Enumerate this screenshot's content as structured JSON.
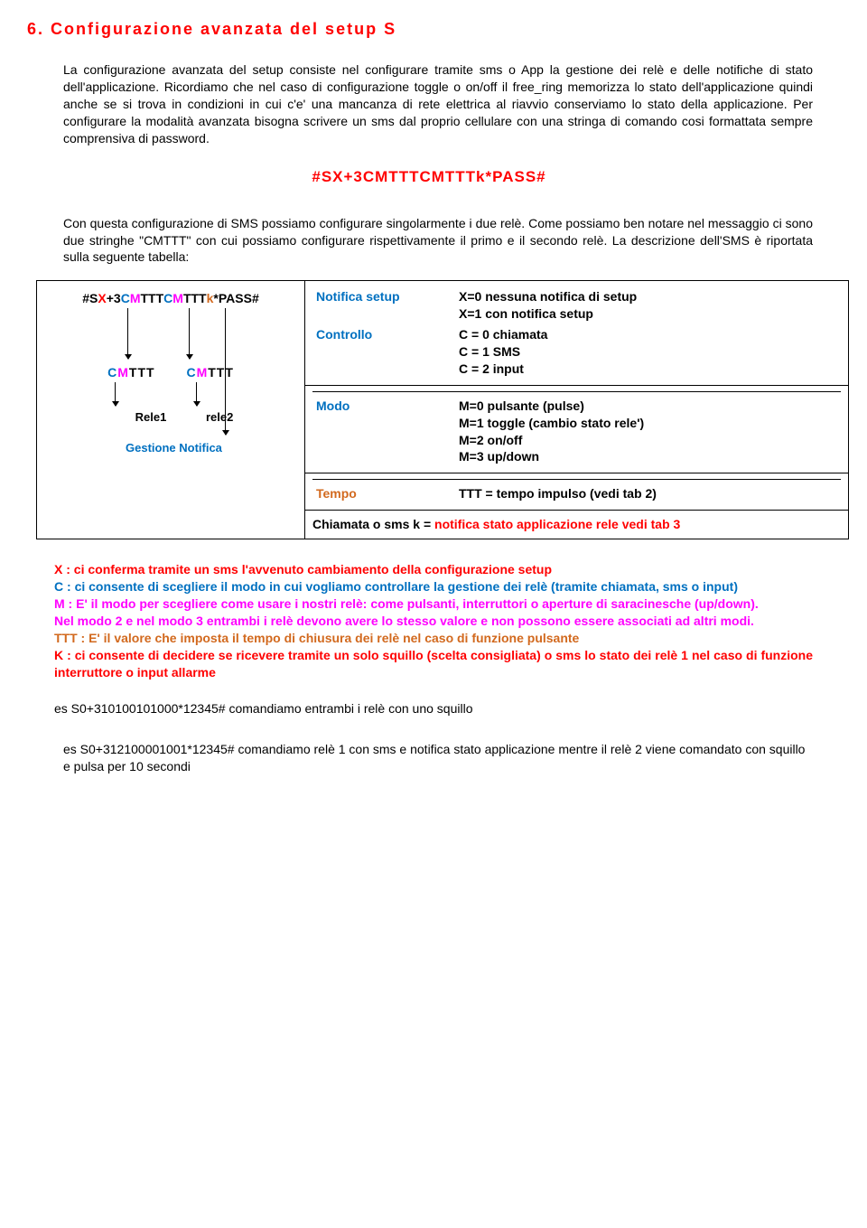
{
  "title": "6. Configurazione avanzata del setup S",
  "intro": "La configurazione avanzata del setup consiste nel configurare tramite sms o App la gestione dei relè e delle notifiche di stato dell'applicazione. Ricordiamo che nel caso di configurazione toggle o on/off il free_ring memorizza lo stato dell'applicazione quindi anche se si trova in condizioni in cui c'e' una mancanza di rete elettrica al riavvio conserviamo lo stato della applicazione. Per configurare la modalità avanzata bisogna scrivere un sms dal proprio cellulare con una stringa di comando cosi formattata sempre comprensiva di password.",
  "command": "#SX+3CMTTTCMTTTk*PASS#",
  "after": "Con questa configurazione di SMS possiamo configurare singolarmente i due relè. Come possiamo ben notare nel messaggio ci sono due stringhe \"CMTTT\" con cui possiamo configurare rispettivamente il primo e il secondo relè. La descrizione dell'SMS è riportata sulla seguente tabella:",
  "diagram": {
    "top": "#SX+3CMTTTCMTTTk*PASS#",
    "cm1": "CMTTT",
    "cm2": "CMTTT",
    "rele1": "Rele1",
    "rele2": "rele2",
    "gest": "Gestione Notifica"
  },
  "table": {
    "notifica_lbl": "Notifica setup",
    "notifica_val": "X=0 nessuna notifica di setup\nX=1 con notifica setup",
    "controllo_lbl": "Controllo",
    "controllo_val": "C = 0 chiamata\nC = 1 SMS\nC = 2 input",
    "modo_lbl": "Modo",
    "modo_val": "M=0 pulsante (pulse)\nM=1 toggle (cambio stato rele')\nM=2 on/off\nM=3 up/down",
    "tempo_lbl": "Tempo",
    "tempo_val": "TTT = tempo impulso (vedi tab 2)",
    "chiamata_pre": "Chiamata o sms k = ",
    "chiamata_hl": "notifica stato applicazione rele vedi tab 3"
  },
  "legend": {
    "x_lbl": "X",
    "x_txt": " : ci conferma tramite un sms l'avvenuto cambiamento della configurazione setup",
    "c_lbl": "C",
    "c_txt": " : ci consente di scegliere il modo in cui vogliamo controllare la gestione dei relè (tramite chiamata, sms o input)",
    "m_lbl": "M",
    "m_txt1": " : E' il modo per scegliere come usare i nostri relè: come pulsanti, interruttori o aperture di saracinesche (up/down).",
    "m_txt2": "Nel modo 2 e nel modo 3 entrambi i relè devono avere lo stesso valore e non possono essere associati ad altri modi.",
    "t_lbl": "TTT",
    "t_txt": " : E' il valore che imposta il tempo di chiusura dei relè nel caso di funzione pulsante",
    "k_lbl": "K",
    "k_txt": " : ci consente di decidere se ricevere tramite un solo squillo (scelta consigliata) o sms lo stato dei relè 1 nel caso di funzione interruttore o input allarme"
  },
  "ex1": "es  S0+310100101000*12345# comandiamo entrambi i relè con uno squillo",
  "ex2": "es S0+312100001001*12345# comandiamo relè 1 con sms e notifica stato applicazione mentre il relè 2 viene comandato con squillo e pulsa per 10 secondi"
}
